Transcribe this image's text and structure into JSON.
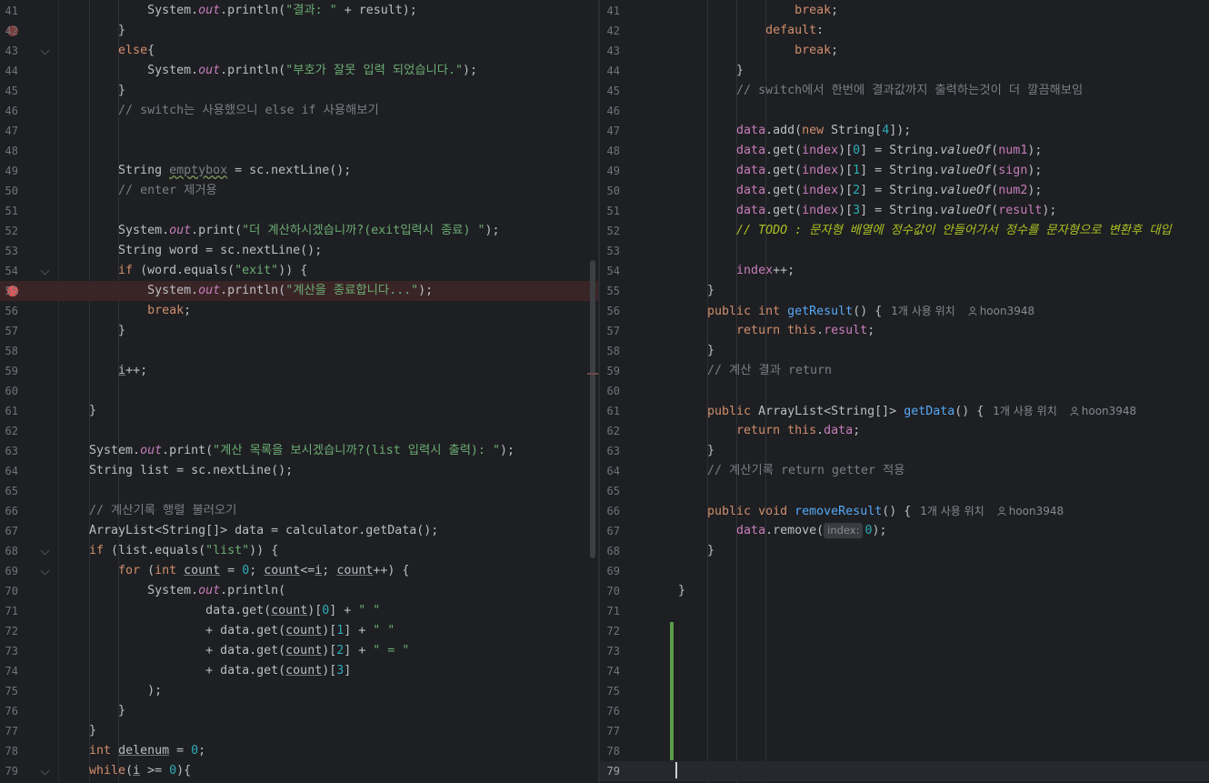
{
  "left_editor": {
    "line_numbers": [
      "41",
      "42",
      "43",
      "44",
      "45",
      "46",
      "47",
      "48",
      "49",
      "50",
      "51",
      "52",
      "53",
      "54",
      "55",
      "56",
      "57",
      "58",
      "59",
      "60",
      "61",
      "62",
      "63",
      "64",
      "65",
      "66",
      "67",
      "68",
      "69",
      "70",
      "71",
      "72",
      "73",
      "74",
      "75",
      "76",
      "77",
      "78",
      "79"
    ],
    "strings": {
      "l41": "\"결과: \"",
      "l44": "\"부호가 잘못 입력 되었습니다.\"",
      "l46": "// switch는 사용했으니 else if 사용해보기",
      "l50": "// enter 제거용",
      "l52": "\"더 계산하시겠습니까?(exit입력시 종료) \"",
      "l54": "\"exit\"",
      "l55": "\"계산을 종료합니다...\"",
      "l63": "\"계산 목록을 보시겠습니까?(list 입력시 출력): \"",
      "l66": "// 계산기록 행렬 불러오기",
      "l68": "\"list\"",
      "l71": "\" \"",
      "l72": "\" \"",
      "l73": "\" = \""
    }
  },
  "right_editor": {
    "line_numbers": [
      "41",
      "42",
      "43",
      "44",
      "45",
      "46",
      "47",
      "48",
      "49",
      "50",
      "51",
      "52",
      "53",
      "54",
      "55",
      "56",
      "57",
      "58",
      "59",
      "60",
      "61",
      "62",
      "63",
      "64",
      "65",
      "66",
      "67",
      "68",
      "69",
      "70",
      "71",
      "72",
      "73",
      "74",
      "75",
      "76",
      "77",
      "78",
      "79"
    ],
    "strings": {
      "l45": "// switch에서 한번에 결과값까지 출력하는것이 더 깔끔해보임",
      "l52": "// TODO : 문자형 배열에 정수값이 안들어가서 정수를 문자형으로 변환후 대입",
      "l59": "// 계산 결과 return",
      "l64": "// 계산기록 return getter 적용",
      "usage_hint": "1개 사용 위치",
      "author": "hoon3948",
      "param_hint": "index:"
    }
  },
  "colors": {
    "background": "#1e1f22",
    "keyword": "#cf8e6d",
    "string": "#6aab73",
    "comment": "#7a7e85",
    "number": "#2aacb8",
    "method": "#56a8f5",
    "field": "#c77dbb",
    "todo": "#a8c023",
    "breakpoint": "#e55757",
    "vcs_added": "#5b9a4c"
  },
  "icons": [
    "breakpoint-icon",
    "fold-arrow-icon",
    "user-icon"
  ]
}
